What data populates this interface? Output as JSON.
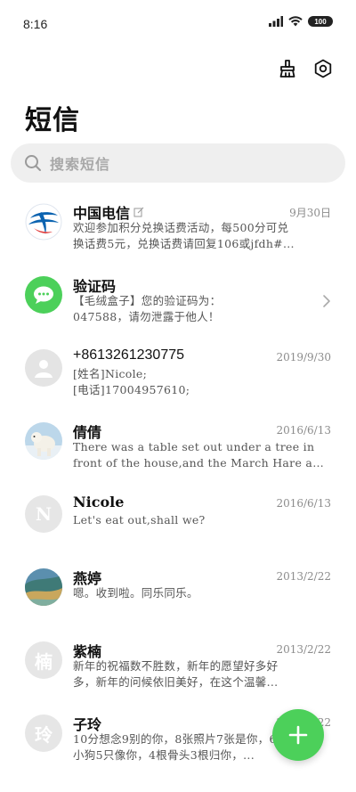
{
  "status_bar": {
    "time": "8:16",
    "battery": "100"
  },
  "header": {
    "title": "短信"
  },
  "search": {
    "placeholder": "搜索短信"
  },
  "messages": [
    {
      "name": "中国电信",
      "date": "9月30日",
      "line1": "欢迎参加积分兑换话费活动，每500分可兑",
      "line2": "换话费5元，兑换话费请回复106或jfdh#..."
    },
    {
      "name": "验证码",
      "date": "",
      "line1": "【毛绒盒子】您的验证码为：",
      "line2": "047588，请勿泄露于他人！"
    },
    {
      "name": "+8613261230775",
      "date": "2019/9/30",
      "line1": "[姓名]Nicole;",
      "line2": "[电话]17004957610;"
    },
    {
      "name": "倩倩",
      "date": "2016/6/13",
      "line1": "There was a table set out under a tree in",
      "line2": "front of the house,and the March Hare and ..."
    },
    {
      "name": "Nicole",
      "date": "2016/6/13",
      "avatar_letter": "N",
      "line1": "Let's eat out,shall we?",
      "line2": ""
    },
    {
      "name": "燕婷",
      "date": "2013/2/22",
      "line1": "嗯。收到啦。同乐同乐。",
      "line2": ""
    },
    {
      "name": "紫楠",
      "date": "2013/2/22",
      "avatar_letter": "楠",
      "line1": "新年的祝福数不胜数，新年的愿望好多好",
      "line2": "多，新年的问候依旧美好，在这个温馨..."
    },
    {
      "name": "子玲",
      "date": "2013/2/22",
      "avatar_letter": "玲",
      "line1": "10分想念9别的你，8张照片7张是你，6只",
      "line2": "小狗5只像你，4根骨头3根归你，..."
    }
  ],
  "colors": {
    "accent": "#4cd05a",
    "telecom_blue": "#0b63b0"
  }
}
